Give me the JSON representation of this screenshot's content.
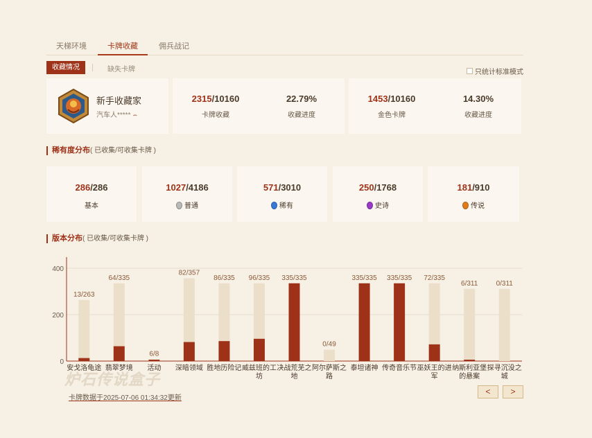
{
  "tabs": [
    {
      "label": "天梯环境"
    },
    {
      "label": "卡牌收藏"
    },
    {
      "label": "佣兵战记"
    }
  ],
  "subtabs": {
    "active": "收藏情况",
    "other": "缺失卡牌"
  },
  "standard_toggle": "只统计标准模式",
  "user": {
    "title": "新手收藏家",
    "name": "汽车人*****"
  },
  "stats": {
    "cards": {
      "owned": "2315",
      "total": "/10160",
      "label": "卡牌收藏"
    },
    "cards_progress": {
      "value": "22.79%",
      "label": "收藏进度"
    },
    "golden": {
      "owned": "1453",
      "total": "/10160",
      "label": "金色卡牌"
    },
    "golden_progress": {
      "value": "14.30%",
      "label": "收藏进度"
    }
  },
  "rarity_section": {
    "title": "稀有度分布",
    "sub": "( 已收集/可收集卡牌 )"
  },
  "rarity": [
    {
      "owned": "286",
      "total": "/286",
      "label": "基本",
      "gem_color": ""
    },
    {
      "owned": "1027",
      "total": "/4186",
      "label": "普通",
      "gem_color": "#b9b9b9"
    },
    {
      "owned": "571",
      "total": "/3010",
      "label": "稀有",
      "gem_color": "#3a78d8"
    },
    {
      "owned": "250",
      "total": "/1768",
      "label": "史诗",
      "gem_color": "#9a3ac8"
    },
    {
      "owned": "181",
      "total": "/910",
      "label": "传说",
      "gem_color": "#e27a1a"
    }
  ],
  "version_section": {
    "title": "版本分布",
    "sub": "( 已收集/可收集卡牌 )"
  },
  "chart_data": {
    "type": "bar",
    "ylim": [
      0,
      400
    ],
    "yticks": [
      "0",
      "200",
      "400"
    ],
    "categories": [
      "安戈洛龟途",
      "翡翠梦境",
      "活动",
      "深暗领域",
      "胜地历险记",
      "威兹班的工坊",
      "决战荒芜之地",
      "阿尔萨斯之路",
      "泰坦诸神",
      "传奇音乐节",
      "巫妖王的进军",
      "纳斯利亚堡的悬案",
      "探寻沉没之城"
    ],
    "series": [
      {
        "values": [
          13,
          64,
          6,
          82,
          86,
          96,
          335,
          0,
          335,
          335,
          72,
          6,
          0
        ]
      },
      {
        "values": [
          263,
          335,
          8,
          357,
          335,
          335,
          335,
          49,
          335,
          335,
          335,
          311,
          311
        ]
      }
    ],
    "data_labels": [
      "13/263",
      "64/335",
      "6/8",
      "82/357",
      "86/335",
      "96/335",
      "335/335",
      "0/49",
      "335/335",
      "335/335",
      "72/335",
      "6/311",
      "0/311"
    ],
    "colors": {
      "owned": "#9e3218",
      "total": "#ebdfca",
      "axis": "#9e3218",
      "grid": "#e6dccb"
    }
  },
  "footer": {
    "note": "卡牌数据于2025-07-06 01:34:32更新",
    "watermark": "炉石传说盒子"
  },
  "pager": {
    "prev": "<",
    "next": ">"
  }
}
